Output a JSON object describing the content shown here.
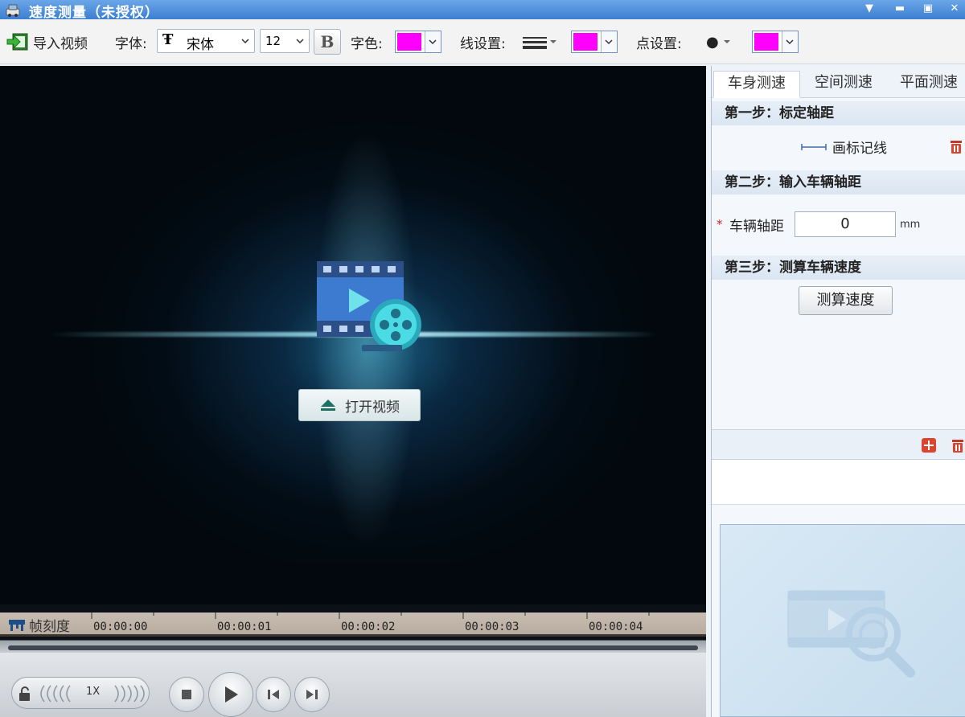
{
  "window": {
    "title": "速度测量（未授权）"
  },
  "toolbar": {
    "import_label": "导入视频",
    "font_label": "字体:",
    "font_value": "宋体",
    "size_value": "12",
    "bold_label": "B",
    "font_color_label": "字色:",
    "line_label": "线设置:",
    "point_label": "点设置:",
    "point_glyph": "●",
    "swatch_color": "#ff00ff"
  },
  "video": {
    "open_label": "打开视频"
  },
  "timeline": {
    "label": "帧刻度",
    "ticks": [
      "00:00:00",
      "00:00:01",
      "00:00:02",
      "00:00:03",
      "00:00:04"
    ]
  },
  "controls": {
    "speed_label": "1X"
  },
  "panel": {
    "tabs": [
      "车身测速",
      "空间测速",
      "平面测速"
    ],
    "step1": "第一步：标定轴距",
    "draw_line_label": "画标记线",
    "step2": "第二步：输入车辆轴距",
    "required_mark": "*",
    "wheelbase_label": "车辆轴距",
    "wheelbase_value": "0",
    "wheelbase_unit": "mm",
    "step3": "第三步：测算车辆速度",
    "calc_label": "测算速度"
  }
}
